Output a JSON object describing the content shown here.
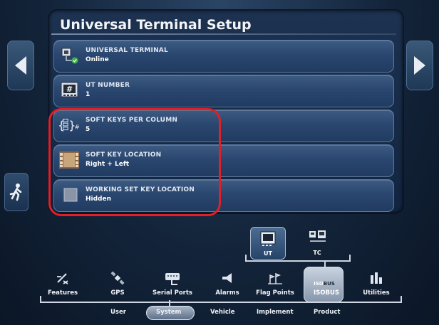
{
  "title": "Universal Terminal Setup",
  "rows": [
    {
      "label": "UNIVERSAL TERMINAL",
      "value": "Online",
      "icon": "terminal-online-icon"
    },
    {
      "label": "UT NUMBER",
      "value": "1",
      "icon": "number-hash-icon"
    },
    {
      "label": "SOFT KEYS PER COLUMN",
      "value": "5",
      "icon": "softkeys-per-column-icon"
    },
    {
      "label": "SOFT KEY LOCATION",
      "value": "Right + Left",
      "icon": "softkey-location-icon"
    },
    {
      "label": "WORKING SET KEY LOCATION",
      "value": "Hidden",
      "icon": "working-set-key-icon"
    }
  ],
  "tabs_top": [
    {
      "label": "UT",
      "active": true
    },
    {
      "label": "TC",
      "active": false
    }
  ],
  "categories": [
    {
      "label": "Features",
      "active": false
    },
    {
      "label": "GPS",
      "active": false
    },
    {
      "label": "Serial Ports",
      "active": false
    },
    {
      "label": "Alarms",
      "active": false
    },
    {
      "label": "Flag Points",
      "active": false
    },
    {
      "label": "ISOBUS",
      "active": true,
      "badge": "ISOBUS"
    },
    {
      "label": "Utilities",
      "active": false
    }
  ],
  "sub_tabs": [
    {
      "label": "User",
      "active": false
    },
    {
      "label": "System",
      "active": true
    },
    {
      "label": "Vehicle",
      "active": false
    },
    {
      "label": "Implement",
      "active": false
    },
    {
      "label": "Product",
      "active": false
    }
  ],
  "colors": {
    "highlight": "#e01f26",
    "row_bg": "#2a4770",
    "background": "#13243a"
  }
}
